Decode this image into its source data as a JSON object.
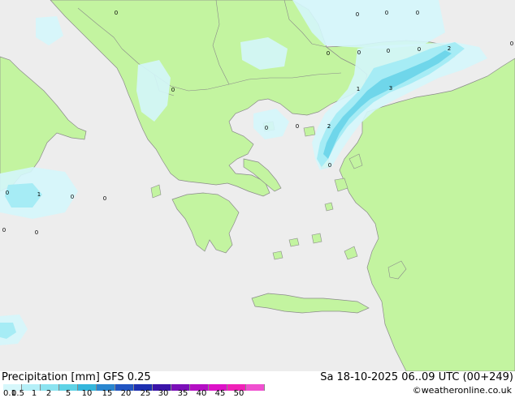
{
  "legend": {
    "title_left": "Precipitation [mm]  GFS 0.25",
    "title_right": "Sa 18-10-2025 06..09 UTC (00+249)",
    "credit": "©weatheronline.co.uk",
    "scale_values": [
      "0.1",
      "0.5",
      "1",
      "2",
      "5",
      "10",
      "15",
      "20",
      "25",
      "30",
      "35",
      "40",
      "45",
      "50"
    ],
    "scale_colors": [
      "#d6f7fb",
      "#b5eff7",
      "#8ce3f0",
      "#5fd3e6",
      "#34b6dc",
      "#2a86cf",
      "#2255c2",
      "#1d2fb0",
      "#3a14a8",
      "#7b10b8",
      "#b40fc4",
      "#dd12c8",
      "#f021b8",
      "#f050d0"
    ]
  },
  "map": {
    "colors": {
      "sea": "#ededed",
      "land": "#c3f4a0",
      "border": "#8a8a8a",
      "precip_light": "#d4f6fb",
      "precip_mid": "#a6ecf5",
      "precip_heavy": "#6fd6ea"
    },
    "values": [
      {
        "label": "0"
      },
      {
        "label": "0"
      },
      {
        "label": "0"
      },
      {
        "label": "0"
      },
      {
        "label": "0"
      },
      {
        "label": "0"
      },
      {
        "label": "0"
      },
      {
        "label": "0"
      },
      {
        "label": "2"
      },
      {
        "label": "0"
      },
      {
        "label": "0"
      },
      {
        "label": "1"
      },
      {
        "label": "3"
      },
      {
        "label": "0"
      },
      {
        "label": "2"
      },
      {
        "label": "0"
      },
      {
        "label": "0"
      },
      {
        "label": "0"
      },
      {
        "label": "1"
      },
      {
        "label": "0"
      },
      {
        "label": "0"
      },
      {
        "label": "0"
      },
      {
        "label": "0"
      },
      {
        "label": "0"
      }
    ]
  }
}
